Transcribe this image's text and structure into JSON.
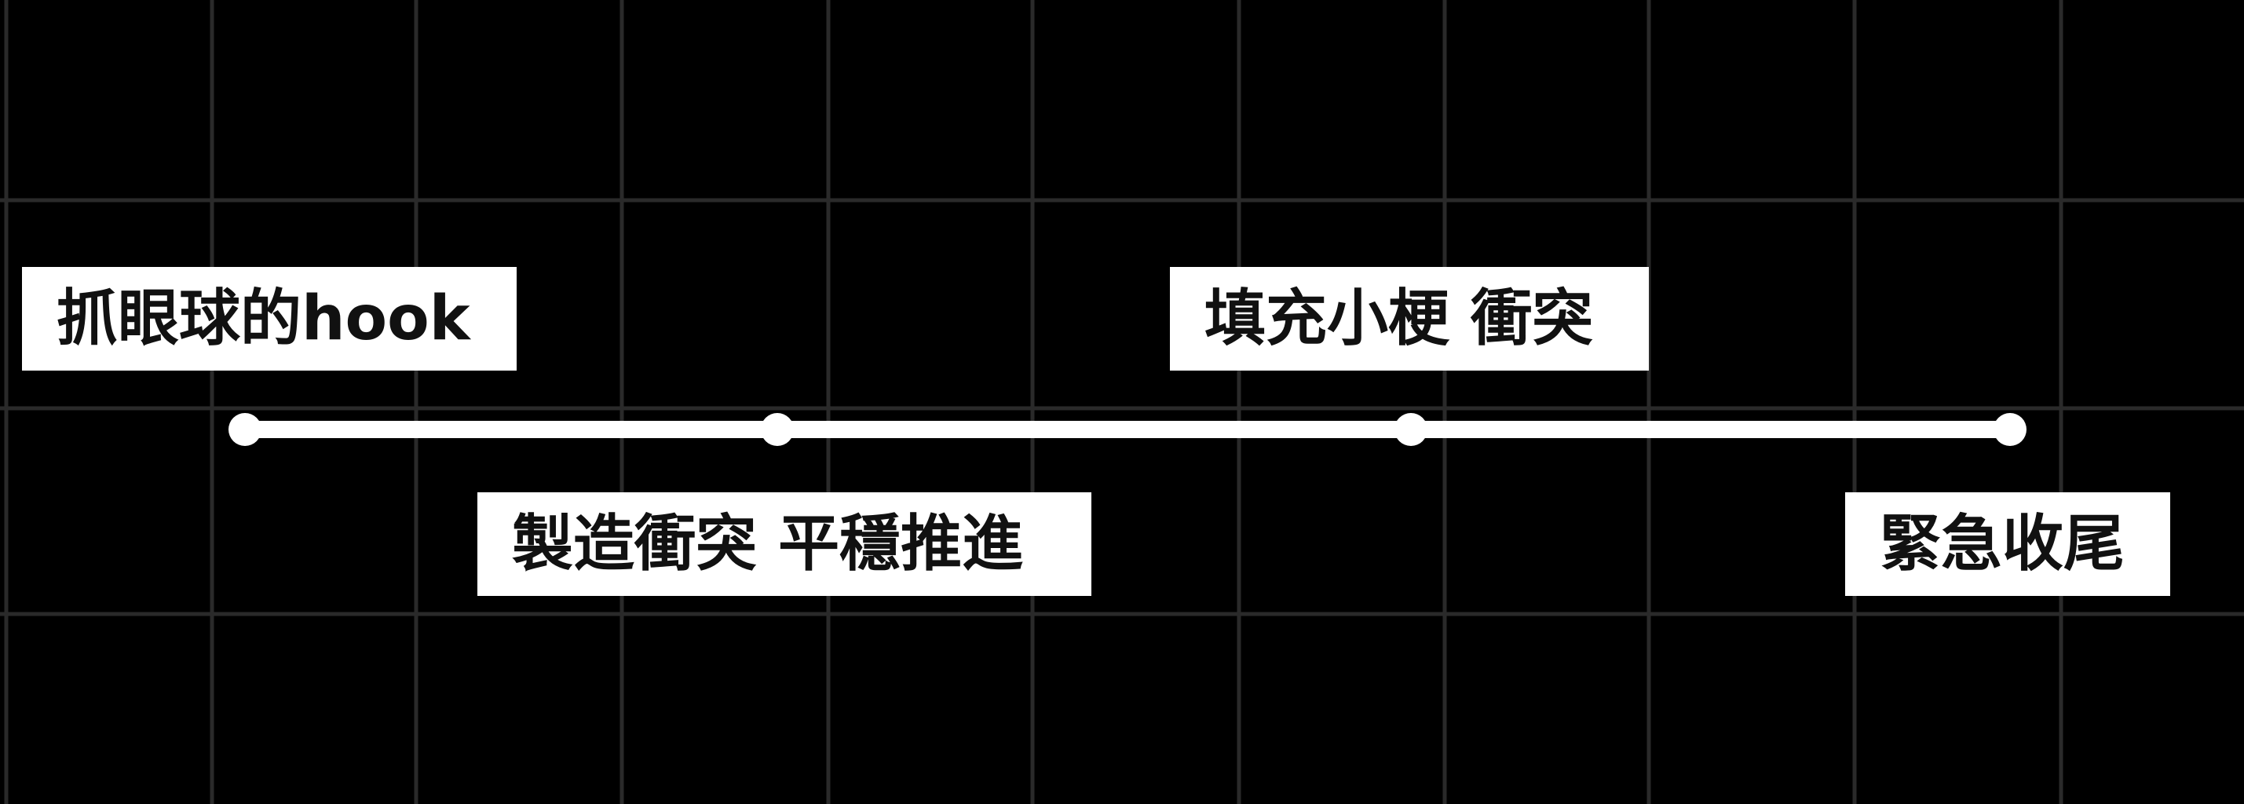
{
  "colors": {
    "background": "#000000",
    "grid": "#2a2a2a",
    "line": "#ffffff",
    "label_bg": "#ffffff",
    "label_text": "#111111"
  },
  "stages": [
    {
      "label": "抓眼球的hook"
    },
    {
      "label": "製造衝突 平穩推進"
    },
    {
      "label": "填充小梗 衝突"
    },
    {
      "label": "緊急收尾"
    }
  ]
}
